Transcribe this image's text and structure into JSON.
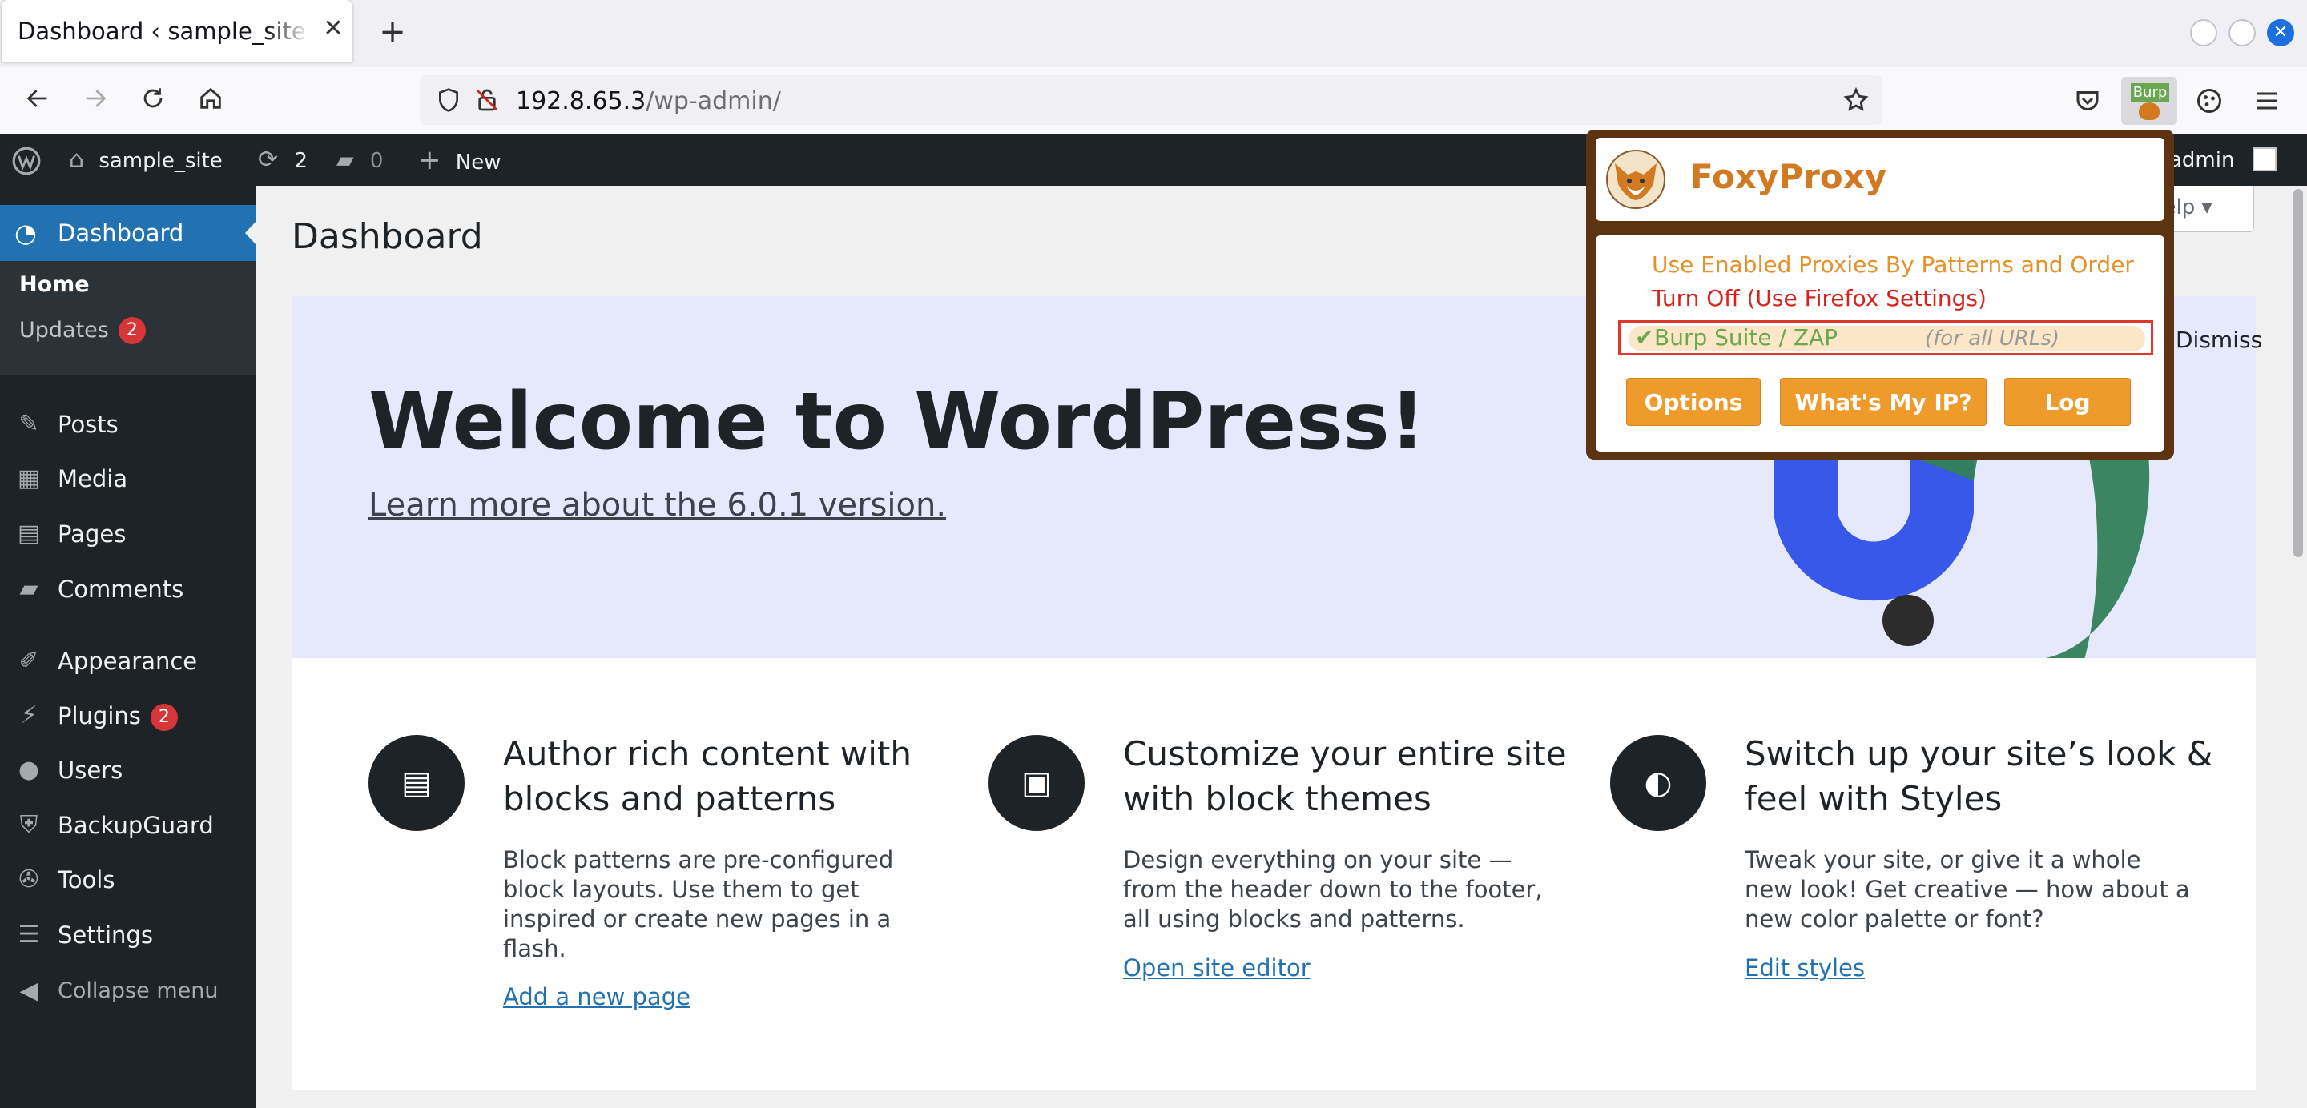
{
  "browser": {
    "tab_title": "Dashboard ‹ sample_site — WordPress",
    "tab_close": "✕",
    "new_tab": "+",
    "url_host": "192.8.65.3",
    "url_path": "/wp-admin/",
    "extension_label": "Burp",
    "window_close": "✕"
  },
  "adminbar": {
    "site_name": "sample_site",
    "updates_count": "2",
    "comments_count": "0",
    "new_label": "New",
    "user": "admin"
  },
  "sidebar": {
    "dashboard": "Dashboard",
    "submenu": [
      {
        "label": "Home"
      },
      {
        "label": "Updates",
        "badge": "2"
      }
    ],
    "items": [
      {
        "label": "Posts",
        "icon": "pin-icon",
        "glyph": "✎"
      },
      {
        "label": "Media",
        "icon": "media-icon",
        "glyph": "▦"
      },
      {
        "label": "Pages",
        "icon": "pages-icon",
        "glyph": "▤"
      },
      {
        "label": "Comments",
        "icon": "comment-icon",
        "glyph": "▰"
      },
      {
        "label": "Appearance",
        "icon": "brush-icon",
        "glyph": "✐"
      },
      {
        "label": "Plugins",
        "icon": "plugin-icon",
        "glyph": "⚡",
        "badge": "2"
      },
      {
        "label": "Users",
        "icon": "user-icon",
        "glyph": "●"
      },
      {
        "label": "BackupGuard",
        "icon": "shield-icon",
        "glyph": "⛨"
      },
      {
        "label": "Tools",
        "icon": "wrench-icon",
        "glyph": "✇"
      },
      {
        "label": "Settings",
        "icon": "settings-icon",
        "glyph": "☰"
      }
    ],
    "collapse": "Collapse menu"
  },
  "main": {
    "page_title": "Dashboard",
    "help": "Help ▾",
    "dismiss": "Dismiss",
    "welcome_title": "Welcome to WordPress!",
    "welcome_link": "Learn more about the 6.0.1 version.",
    "columns": [
      {
        "title": "Author rich content with blocks and patterns",
        "text": "Block patterns are pre-configured block layouts. Use them to get inspired or create new pages in a flash.",
        "link": "Add a new page",
        "glyph": "▤"
      },
      {
        "title": "Customize your entire site with block themes",
        "text": "Design everything on your site — from the header down to the footer, all using blocks and patterns.",
        "link": "Open site editor",
        "glyph": "▣"
      },
      {
        "title": "Switch up your site’s look & feel with Styles",
        "text": "Tweak your site, or give it a whole new look! Get creative — how about a new color palette or font?",
        "link": "Edit styles",
        "glyph": "◐"
      }
    ]
  },
  "foxyproxy": {
    "title": "FoxyProxy",
    "options": [
      {
        "label": "Use Enabled Proxies By Patterns and Order",
        "color": "#e8902a"
      },
      {
        "label": "Turn Off (Use Firefox Settings)",
        "color": "#d8231d"
      }
    ],
    "selected": {
      "check": "✔",
      "label": "Burp Suite / ZAP",
      "note": "(for all URLs)"
    },
    "buttons": [
      "Options",
      "What's My IP?",
      "Log"
    ]
  },
  "colors": {
    "wp_blue": "#2271b1",
    "wp_dark": "#1d2327",
    "fox_brown": "#5c3412",
    "fox_orange": "#ef9b2b"
  }
}
